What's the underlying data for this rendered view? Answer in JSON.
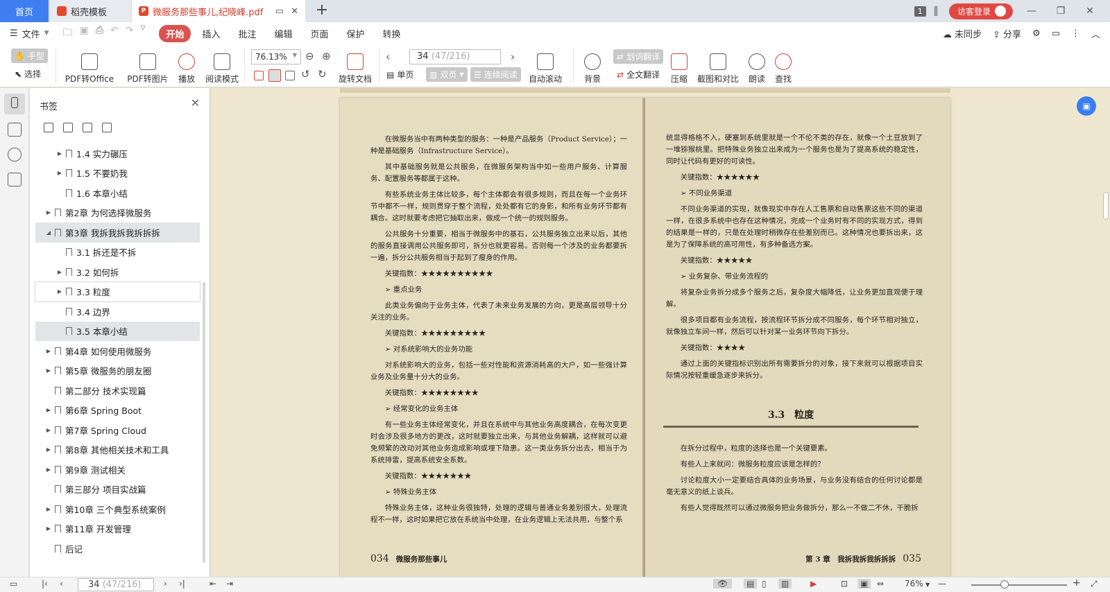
{
  "tabs": {
    "home": "首页",
    "template": "稻壳模板",
    "document": "微服务那些事儿,纪晓峰.pdf",
    "add": "+"
  },
  "window": {
    "badge": "1",
    "login": "访客登录"
  },
  "menu": {
    "file": "文件",
    "tabs": [
      "开始",
      "插入",
      "批注",
      "编辑",
      "页面",
      "保护",
      "转换"
    ],
    "sync": "未同步",
    "share": "分享"
  },
  "ribbon": {
    "hand": "手型",
    "select": "选择",
    "pdf_to_office": "PDF转Office",
    "pdf_to_image": "PDF转图片",
    "play": "播放",
    "read_mode": "阅读模式",
    "zoom": "76.13%",
    "rotate": "旋转文档",
    "page_current": "34",
    "page_total": "(47/216)",
    "single": "单页",
    "double": "双页",
    "continuous": "连续阅读",
    "autoscroll": "自动滚动",
    "background": "背景",
    "word_translate": "划词翻译",
    "full_translate": "全文翻译",
    "compress": "压缩",
    "screenshot_compare": "截图和对比",
    "read_aloud": "朗读",
    "find": "查找"
  },
  "bookmarks": {
    "title": "书签",
    "items": [
      {
        "label": "1.4 实力碾压",
        "level": 2,
        "arrow": "▶"
      },
      {
        "label": "1.5 不要奶我",
        "level": 2,
        "arrow": "▶"
      },
      {
        "label": "1.6 本章小结",
        "level": 2,
        "arrow": ""
      },
      {
        "label": "第2章 为何选择微服务",
        "level": 1,
        "arrow": "▶"
      },
      {
        "label": "第3章 我拆我拆我拆拆拆",
        "level": 1,
        "arrow": "◢",
        "state": "sel"
      },
      {
        "label": "3.1 拆还是不拆",
        "level": 2,
        "arrow": ""
      },
      {
        "label": "3.2 如何拆",
        "level": 2,
        "arrow": "▶"
      },
      {
        "label": "3.3 粒度",
        "level": 2,
        "arrow": "▶",
        "state": "hover"
      },
      {
        "label": "3.4 边界",
        "level": 2,
        "arrow": ""
      },
      {
        "label": "3.5 本章小结",
        "level": 2,
        "arrow": "",
        "state": "sel"
      },
      {
        "label": "第4章 如何使用微服务",
        "level": 1,
        "arrow": "▶"
      },
      {
        "label": "第5章 微服务的朋友圈",
        "level": 1,
        "arrow": "▶"
      },
      {
        "label": "第二部分 技术实现篇",
        "level": 1,
        "arrow": ""
      },
      {
        "label": "第6章 Spring Boot",
        "level": 1,
        "arrow": "▶"
      },
      {
        "label": "第7章 Spring Cloud",
        "level": 1,
        "arrow": "▶"
      },
      {
        "label": "第8章 其他相关技术和工具",
        "level": 1,
        "arrow": "▶"
      },
      {
        "label": "第9章 测试相关",
        "level": 1,
        "arrow": "▶"
      },
      {
        "label": "第三部分 项目实战篇",
        "level": 1,
        "arrow": ""
      },
      {
        "label": "第10章 三个典型系统案例",
        "level": 1,
        "arrow": "▶"
      },
      {
        "label": "第11章 开发管理",
        "level": 1,
        "arrow": "▶"
      },
      {
        "label": "后记",
        "level": 1,
        "arrow": ""
      }
    ]
  },
  "page_left": {
    "paragraphs": [
      {
        "t": "在微服务当中有两种类型的服务：一种是产品服务（Product Service）；一种是基础服务（Infrastructure Service）。",
        "c": ""
      },
      {
        "t": "其中基础服务就是公共服务，在微服务架构当中如一些用户服务、计算服务、配置服务等都属于这种。",
        "c": ""
      },
      {
        "t": "有些系统业务主体比较多，每个主体都会有很多规则，而且在每一个业务环节中都不一样，规则贯穿于整个流程，处处都有它的身影，和所有业务环节都有耦合。这时就要考虑把它抽取出来，做成一个统一的规则服务。",
        "c": ""
      },
      {
        "t": "公共服务十分重要，相当于微服务中的基石，公共服务独立出来以后，其他的服务直接调用公共服务即可，拆分也就更容易。否则每一个涉及的业务都要拆一遍，拆分公共服务相当于起到了瘦身的作用。",
        "c": ""
      },
      {
        "t": "关键指数：★★★★★★★★★★",
        "c": "key"
      },
      {
        "t": "➢ 重点业务",
        "c": "bul"
      },
      {
        "t": "此类业务偏向于业务主体，代表了未来业务发展的方向，更是高层领导十分关注的业务。",
        "c": ""
      },
      {
        "t": "关键指数：★★★★★★★★★",
        "c": "key"
      },
      {
        "t": "➢ 对系统影响大的业务功能",
        "c": "bul"
      },
      {
        "t": "对系统影响大的业务，包括一些对性能和资源消耗高的大户，如一些强计算业务及业务量十分大的业务。",
        "c": ""
      },
      {
        "t": "关键指数：★★★★★★★★",
        "c": "key"
      },
      {
        "t": "➢ 经常变化的业务主体",
        "c": "bul"
      },
      {
        "t": "有一些业务主体经常变化，并且在系统中与其他业务高度耦合，在每次变更时会涉及很多地方的更改，这时就要独立出来，与其他业务解耦，这样就可以避免频繁的改动对其他业务造成影响或埋下隐患。这一类业务拆分出去，相当于为系统排雷，提高系统安全系数。",
        "c": ""
      },
      {
        "t": "关键指数：★★★★★★★",
        "c": "key"
      },
      {
        "t": "➢ 特殊业务主体",
        "c": "bul"
      },
      {
        "t": "特殊业务主体，这种业务很独特，处理的逻辑与普通业务差别很大，处理流程不一样，这时如果把它放在系统当中处理，在业务逻辑上无法共用，与整个系",
        "c": ""
      }
    ],
    "page_num": "034",
    "page_title": "微服务那些事儿"
  },
  "page_right": {
    "paragraphs_a": [
      {
        "t": "统显得格格不入，硬塞到系统里就是一个不伦不类的存在，就像一个土豆放到了一堆猕猴桃里。把特殊业务独立出来成为一个服务也是为了提高系统的稳定性，同时让代码有更好的可读性。",
        "c": "noind"
      },
      {
        "t": "关键指数：★★★★★★",
        "c": "key"
      },
      {
        "t": "➢ 不同业务渠道",
        "c": "bul"
      },
      {
        "t": "不同业务渠道的实现，就像现实中存在人工售票和自动售票这些不同的渠道一样，在很多系统中也存在这种情况，完成一个业务时有不同的实现方式，得到的结果是一样的，只是在处理时稍微存在些差别而已。这种情况也要拆出来，这是为了保障系统的高可用性，有多种备选方案。",
        "c": ""
      },
      {
        "t": "关键指数：★★★★★",
        "c": "key"
      },
      {
        "t": "➢ 业务复杂、带业务流程的",
        "c": "bul"
      },
      {
        "t": "将复杂业务拆分成多个服务之后，复杂度大幅降低，让业务更加直观便于理解。",
        "c": ""
      },
      {
        "t": "很多项目都有业务流程，按流程环节拆分成不同服务，每个环节相对独立，就像独立车间一样，然后可以针对某一业务环节向下拆分。",
        "c": ""
      },
      {
        "t": "关键指数：★★★★",
        "c": "key"
      },
      {
        "t": "通过上面的关键指标识别出所有需要拆分的对象，接下来就可以根据项目实际情况按轻重缓急逐步来拆分。",
        "c": ""
      }
    ],
    "section_title": "3.3　粒度",
    "paragraphs_b": [
      {
        "t": "在拆分过程中，粒度的选择也是一个关键要素。",
        "c": ""
      },
      {
        "t": "有些人上来就问：微服务粒度应该是怎样的？",
        "c": ""
      },
      {
        "t": "讨论粒度大小一定要结合具体的业务场景，与业务没有结合的任何讨论都是毫无意义的纸上谈兵。",
        "c": ""
      },
      {
        "t": "有些人觉得既然可以通过微服务把业务做拆分，那么一不做二不休，干脆拆",
        "c": ""
      }
    ],
    "page_num": "035",
    "page_title": "第 3 章　我拆我拆我拆拆拆"
  },
  "status": {
    "page_current": "34",
    "page_total": "(47/216)",
    "zoom": "76%",
    "zoom_level_percent": 76
  }
}
